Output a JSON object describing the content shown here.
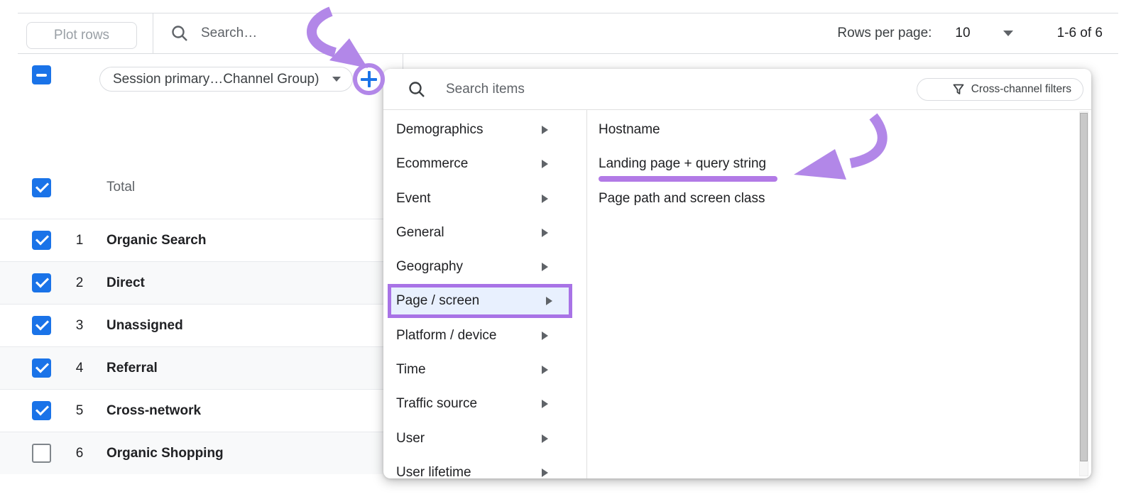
{
  "toolbar": {
    "plot_rows_label": "Plot rows",
    "search_placeholder": "Search…",
    "rows_per_page_label": "Rows per page:",
    "rows_per_page_value": "10",
    "page_range": "1-6 of 6"
  },
  "dimension_header": {
    "selected_dimension": "Session primary…Channel Group)"
  },
  "table": {
    "total_label": "Total",
    "rows": [
      {
        "index": "1",
        "label": "Organic Search",
        "checked": true
      },
      {
        "index": "2",
        "label": "Direct",
        "checked": true
      },
      {
        "index": "3",
        "label": "Unassigned",
        "checked": true
      },
      {
        "index": "4",
        "label": "Referral",
        "checked": true
      },
      {
        "index": "5",
        "label": "Cross-network",
        "checked": true
      },
      {
        "index": "6",
        "label": "Organic Shopping",
        "checked": false
      }
    ]
  },
  "dimension_picker": {
    "search_placeholder": "Search items",
    "filters_button_label": "Cross-channel filters",
    "categories": [
      {
        "label": "Demographics",
        "selected": false
      },
      {
        "label": "Ecommerce",
        "selected": false
      },
      {
        "label": "Event",
        "selected": false
      },
      {
        "label": "General",
        "selected": false
      },
      {
        "label": "Geography",
        "selected": false
      },
      {
        "label": "Page / screen",
        "selected": true
      },
      {
        "label": "Platform / device",
        "selected": false
      },
      {
        "label": "Time",
        "selected": false
      },
      {
        "label": "Traffic source",
        "selected": false
      },
      {
        "label": "User",
        "selected": false
      },
      {
        "label": "User lifetime",
        "selected": false
      }
    ],
    "submenu_items": [
      {
        "label": "Hostname",
        "underlined": false
      },
      {
        "label": "Landing page + query string",
        "underlined": true
      },
      {
        "label": "Page path and screen class",
        "underlined": false
      }
    ]
  },
  "icons": {
    "search": "magnifier",
    "filter": "funnel",
    "add_dimension": "plus-in-circle",
    "dropdown": "caret-down",
    "submenu": "caret-right",
    "checked": "checkmark",
    "indeterminate": "minus"
  },
  "colors": {
    "accent_blue": "#1a73e8",
    "annotation_purple": "#b287e8",
    "highlight_border_purple": "#a873e6",
    "underline_purple": "#b27ae6",
    "selected_item_bg": "#e8f0fe",
    "row_stripe": "#f8f9fa",
    "border_gray": "#dadce0"
  }
}
